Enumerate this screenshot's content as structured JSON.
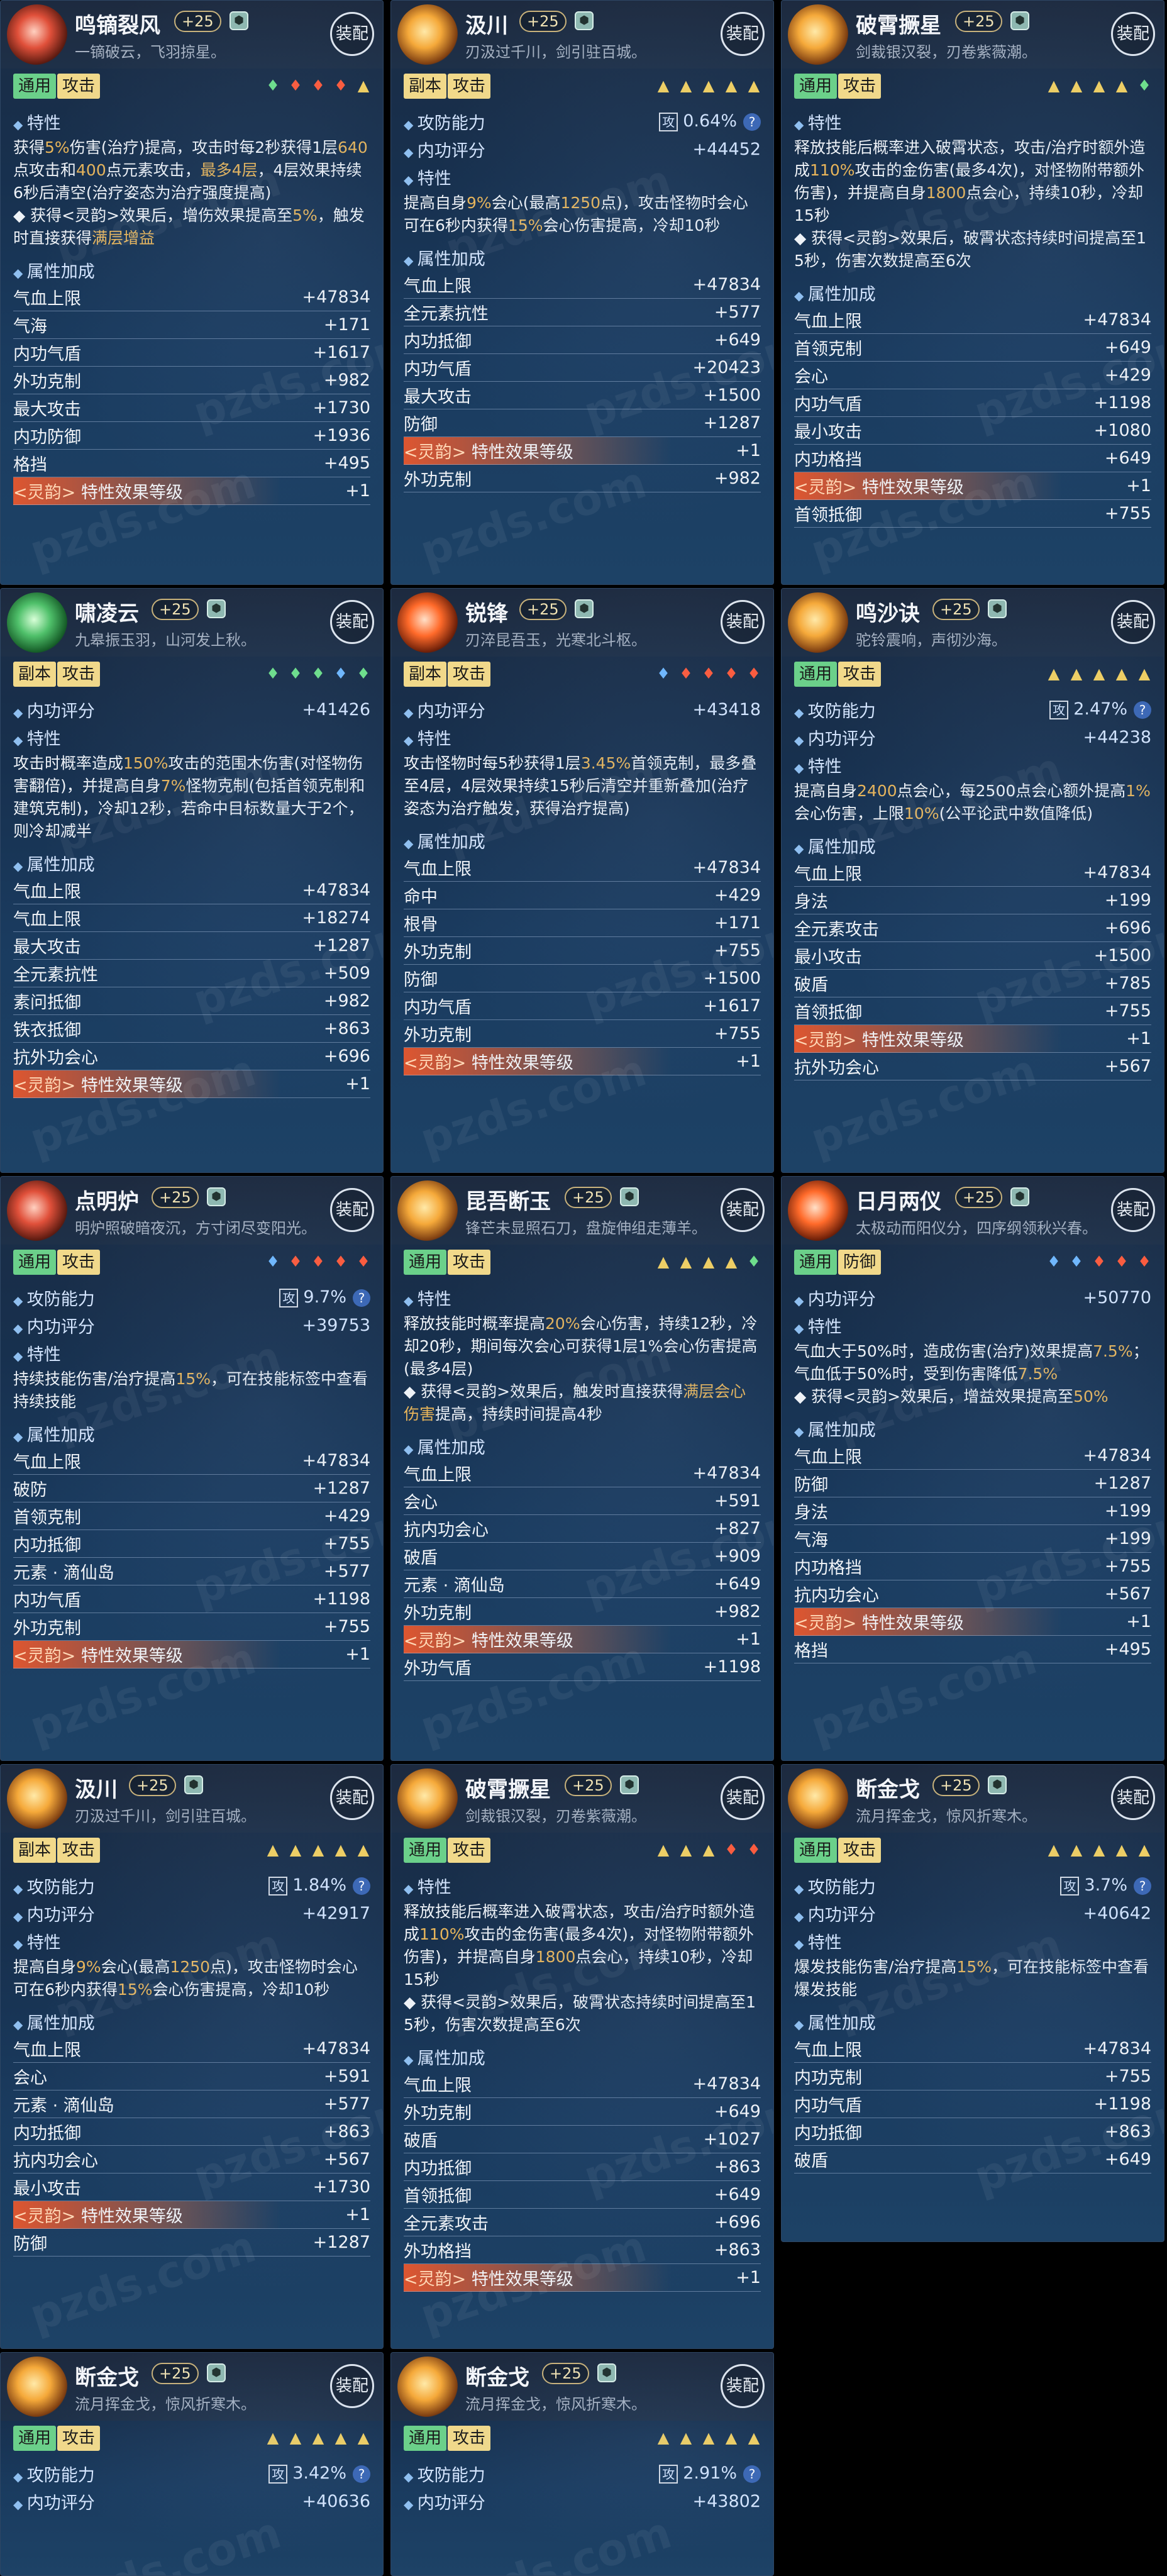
{
  "equip_label": "装配",
  "sections": {
    "trait": "特性",
    "attr": "属性加成"
  },
  "hl_prefix": "<灵韵>",
  "watermark": "pzds.com",
  "cards": [
    {
      "name": "鸣镝裂风",
      "level": "+25",
      "motto": "一镝破云，飞羽掠星。",
      "tags": [
        "通用",
        "攻击"
      ],
      "tag_colors": [
        "g",
        "y"
      ],
      "dots": [
        "wood",
        "fire",
        "fire",
        "fire",
        "bell"
      ],
      "icon": "c1",
      "top": [],
      "desc": [
        {
          "t": "获得"
        },
        {
          "t": "5%",
          "h": 1
        },
        {
          "t": "伤害(治疗)提高，攻击时每2秒获得1层"
        },
        {
          "t": "640",
          "h": 1
        },
        {
          "t": "点攻击和"
        },
        {
          "t": "400",
          "h": 1
        },
        {
          "t": "点元素攻击，"
        },
        {
          "t": "最多4层",
          "h": 1
        },
        {
          "t": "，4层效果持续6秒后清空(治疗姿态为治疗强度提高)"
        },
        {
          "t": "\n◆ 获得<灵韵>效果后，增伤效果提高至"
        },
        {
          "t": "5%",
          "h": 1
        },
        {
          "t": "，触发时直接获得"
        },
        {
          "t": "满层增益",
          "h": 1
        }
      ],
      "attrs": [
        [
          "气血上限",
          "+47834"
        ],
        [
          "气海",
          "+171"
        ],
        [
          "内功气盾",
          "+1617"
        ],
        [
          "外功克制",
          "+982"
        ],
        [
          "最大攻击",
          "+1730"
        ],
        [
          "内功防御",
          "+1936"
        ],
        [
          "格挡",
          "+495"
        ]
      ],
      "hl_index": 7,
      "hl_label": "特性效果等级",
      "hl_val": "+1"
    },
    {
      "name": "汲川",
      "level": "+25",
      "motto": "刃汲过千川，剑引驻百城。",
      "tags": [
        "副本",
        "攻击"
      ],
      "tag_colors": [
        "y",
        "y"
      ],
      "dots": [
        "gold",
        "gold",
        "gold",
        "gold",
        "gold"
      ],
      "icon": "",
      "top": [
        [
          "攻防能力",
          "0.64%",
          true
        ],
        [
          "内功评分",
          "+44452",
          false
        ]
      ],
      "desc": [
        {
          "t": "提高自身"
        },
        {
          "t": "9%",
          "h": 1
        },
        {
          "t": "会心(最高"
        },
        {
          "t": "1250",
          "h": 1
        },
        {
          "t": "点)，攻击怪物时会心可在6秒内获得"
        },
        {
          "t": "15%",
          "h": 1
        },
        {
          "t": "会心伤害提高，冷却10秒"
        }
      ],
      "attrs": [
        [
          "气血上限",
          "+47834"
        ],
        [
          "全元素抗性",
          "+577"
        ],
        [
          "内功抵御",
          "+649"
        ],
        [
          "内功气盾",
          "+20423"
        ],
        [
          "最大攻击",
          "+1500"
        ],
        [
          "防御",
          "+1287"
        ],
        [
          "外功克制",
          "+982"
        ]
      ],
      "hl_index": 6,
      "hl_label": "特性效果等级",
      "hl_val": "+1"
    },
    {
      "name": "破霄撅星",
      "level": "+25",
      "motto": "剑裁银汉裂，刃卷紫薇潮。",
      "tags": [
        "通用",
        "攻击"
      ],
      "tag_colors": [
        "g",
        "y"
      ],
      "dots": [
        "gold",
        "gold",
        "gold",
        "gold",
        "wood"
      ],
      "icon": "",
      "top": [],
      "desc": [
        {
          "t": "释放技能后概率进入破霄状态，攻击/治疗时额外造成"
        },
        {
          "t": "110%",
          "h": 1
        },
        {
          "t": "攻击的金伤害(最多4次)，对怪物附带额外伤害)，并提高自身"
        },
        {
          "t": "1800",
          "h": 1
        },
        {
          "t": "点会心，持续10秒，冷却15秒"
        },
        {
          "t": "\n◆ 获得<灵韵>效果后，破霄状态持续时间提高至15秒，伤害次数提高至6次"
        }
      ],
      "attrs": [
        [
          "气血上限",
          "+47834"
        ],
        [
          "首领克制",
          "+649"
        ],
        [
          "会心",
          "+429"
        ],
        [
          "内功气盾",
          "+1198"
        ],
        [
          "最小攻击",
          "+1080"
        ],
        [
          "内功格挡",
          "+649"
        ],
        [
          "首领抵御",
          "+755"
        ]
      ],
      "hl_index": 6,
      "hl_label": "特性效果等级",
      "hl_val": "+1"
    },
    {
      "name": "啸凌云",
      "level": "+25",
      "motto": "九皋振玉羽，山河发上秋。",
      "tags": [
        "副本",
        "攻击"
      ],
      "tag_colors": [
        "y",
        "y"
      ],
      "dots": [
        "wood",
        "wood",
        "wood",
        "water",
        "wood"
      ],
      "icon": "c2",
      "top": [
        [
          "内功评分",
          "+41426",
          false
        ]
      ],
      "desc": [
        {
          "t": "攻击时概率造成"
        },
        {
          "t": "150%",
          "h": 1
        },
        {
          "t": "攻击的范围木伤害(对怪物伤害翻倍)，并提高自身"
        },
        {
          "t": "7%",
          "h": 1
        },
        {
          "t": "怪物克制(包括首领克制和建筑克制)，冷却12秒，若命中目标数量大于2个，则冷却减半"
        }
      ],
      "attrs": [
        [
          "气血上限",
          "+47834"
        ],
        [
          "气血上限",
          "+18274"
        ],
        [
          "最大攻击",
          "+1287"
        ],
        [
          "全元素抗性",
          "+509"
        ],
        [
          "素问抵御",
          "+982"
        ],
        [
          "铁衣抵御",
          "+863"
        ],
        [
          "抗外功会心",
          "+696"
        ]
      ],
      "hl_index": 7,
      "hl_label": "特性效果等级",
      "hl_val": "+1"
    },
    {
      "name": "锐锋",
      "level": "+25",
      "motto": "刃淬昆吾玉，光寒北斗枢。",
      "tags": [
        "副本",
        "攻击"
      ],
      "tag_colors": [
        "y",
        "y"
      ],
      "dots": [
        "water",
        "fire",
        "fire",
        "fire",
        "fire"
      ],
      "icon": "c3",
      "top": [
        [
          "内功评分",
          "+43418",
          false
        ]
      ],
      "desc": [
        {
          "t": "攻击怪物时每5秒获得1层"
        },
        {
          "t": "3.45%",
          "h": 1
        },
        {
          "t": "首领克制，最多叠至4层，4层效果持续15秒后清空并重新叠加(治疗姿态为治疗触发，获得治疗提高)"
        }
      ],
      "attrs": [
        [
          "气血上限",
          "+47834"
        ],
        [
          "命中",
          "+429"
        ],
        [
          "根骨",
          "+171"
        ],
        [
          "外功克制",
          "+755"
        ],
        [
          "防御",
          "+1500"
        ],
        [
          "内功气盾",
          "+1617"
        ],
        [
          "外功克制",
          "+755"
        ]
      ],
      "hl_index": 7,
      "hl_label": "特性效果等级",
      "hl_val": "+1"
    },
    {
      "name": "鸣沙诀",
      "level": "+25",
      "motto": "驼铃震响，声彻沙海。",
      "tags": [
        "通用",
        "攻击"
      ],
      "tag_colors": [
        "g",
        "y"
      ],
      "dots": [
        "gold",
        "gold",
        "gold",
        "gold",
        "gold"
      ],
      "icon": "",
      "top": [
        [
          "攻防能力",
          "2.47%",
          true
        ],
        [
          "内功评分",
          "+44238",
          false
        ]
      ],
      "desc": [
        {
          "t": "提高自身"
        },
        {
          "t": "2400",
          "h": 1
        },
        {
          "t": "点会心，每2500点会心额外提高"
        },
        {
          "t": "1%",
          "h": 1
        },
        {
          "t": "会心伤害，上限"
        },
        {
          "t": "10%",
          "h": 1
        },
        {
          "t": "(公平论武中数值降低)"
        }
      ],
      "attrs": [
        [
          "气血上限",
          "+47834"
        ],
        [
          "身法",
          "+199"
        ],
        [
          "全元素攻击",
          "+696"
        ],
        [
          "最小攻击",
          "+1500"
        ],
        [
          "破盾",
          "+785"
        ],
        [
          "首领抵御",
          "+755"
        ],
        [
          "抗外功会心",
          "+567"
        ]
      ],
      "hl_index": 6,
      "hl_label": "特性效果等级",
      "hl_val": "+1"
    },
    {
      "name": "点明炉",
      "level": "+25",
      "motto": "明炉照破暗夜沉，方寸闭尽变阳光。",
      "tags": [
        "通用",
        "攻击"
      ],
      "tag_colors": [
        "g",
        "y"
      ],
      "dots": [
        "water",
        "fire",
        "fire",
        "fire",
        "fire"
      ],
      "icon": "c1",
      "top": [
        [
          "攻防能力",
          "9.7%",
          true
        ],
        [
          "内功评分",
          "+39753",
          false
        ]
      ],
      "desc": [
        {
          "t": "持续技能伤害/治疗提高"
        },
        {
          "t": "15%",
          "h": 1
        },
        {
          "t": "，可在技能标签中查看持续技能"
        }
      ],
      "attrs": [
        [
          "气血上限",
          "+47834"
        ],
        [
          "破防",
          "+1287"
        ],
        [
          "首领克制",
          "+429"
        ],
        [
          "内功抵御",
          "+755"
        ],
        [
          "元素 · 滴仙岛",
          "+577"
        ],
        [
          "内功气盾",
          "+1198"
        ],
        [
          "外功克制",
          "+755"
        ]
      ],
      "hl_index": 7,
      "hl_label": "特性效果等级",
      "hl_val": "+1"
    },
    {
      "name": "昆吾断玉",
      "level": "+25",
      "motto": "锋芒未显照石刀，盘旋伸组走薄羊。",
      "tags": [
        "通用",
        "攻击"
      ],
      "tag_colors": [
        "g",
        "y"
      ],
      "dots": [
        "gold",
        "gold",
        "gold",
        "gold",
        "wood"
      ],
      "icon": "",
      "top": [],
      "desc": [
        {
          "t": "释放技能时概率提高"
        },
        {
          "t": "20%",
          "h": 1
        },
        {
          "t": "会心伤害，持续12秒，冷却20秒，期间每次会心可获得1层1%会心伤害提高(最多4层)"
        },
        {
          "t": "\n◆ 获得<灵韵>效果后，触发时直接获得"
        },
        {
          "t": "满层会心伤害",
          "h": 1
        },
        {
          "t": "提高，持续时间提高4秒"
        }
      ],
      "attrs": [
        [
          "气血上限",
          "+47834"
        ],
        [
          "会心",
          "+591"
        ],
        [
          "抗内功会心",
          "+827"
        ],
        [
          "破盾",
          "+909"
        ],
        [
          "元素 · 滴仙岛",
          "+649"
        ],
        [
          "外功克制",
          "+982"
        ],
        [
          "外功气盾",
          "+1198"
        ]
      ],
      "hl_index": 6,
      "hl_label": "特性效果等级",
      "hl_val": "+1"
    },
    {
      "name": "日月两仪",
      "level": "+25",
      "motto": "太极动而阳仪分，四序纲领秋兴春。",
      "tags": [
        "通用",
        "防御"
      ],
      "tag_colors": [
        "g",
        "y"
      ],
      "dots": [
        "water",
        "water",
        "fire",
        "fire",
        "fire"
      ],
      "icon": "c3",
      "top": [
        [
          "内功评分",
          "+50770",
          false
        ]
      ],
      "desc": [
        {
          "t": "气血大于50%时，造成伤害(治疗)效果提高"
        },
        {
          "t": "7.5%",
          "h": 1
        },
        {
          "t": "；气血低于50%时，受到伤害降低"
        },
        {
          "t": "7.5%",
          "h": 1
        },
        {
          "t": "\n◆ 获得<灵韵>效果后，增益效果提高至"
        },
        {
          "t": "50%",
          "h": 1
        }
      ],
      "attrs": [
        [
          "气血上限",
          "+47834"
        ],
        [
          "防御",
          "+1287"
        ],
        [
          "身法",
          "+199"
        ],
        [
          "气海",
          "+199"
        ],
        [
          "内功格挡",
          "+755"
        ],
        [
          "抗内功会心",
          "+567"
        ],
        [
          "格挡",
          "+495"
        ]
      ],
      "hl_index": 6,
      "hl_label": "特性效果等级",
      "hl_val": "+1"
    },
    {
      "name": "汲川",
      "level": "+25",
      "motto": "刃汲过千川，剑引驻百城。",
      "tags": [
        "副本",
        "攻击"
      ],
      "tag_colors": [
        "y",
        "y"
      ],
      "dots": [
        "gold",
        "gold",
        "gold",
        "gold",
        "gold"
      ],
      "icon": "",
      "top": [
        [
          "攻防能力",
          "1.84%",
          true
        ],
        [
          "内功评分",
          "+42917",
          false
        ]
      ],
      "desc": [
        {
          "t": "提高自身"
        },
        {
          "t": "9%",
          "h": 1
        },
        {
          "t": "会心(最高"
        },
        {
          "t": "1250",
          "h": 1
        },
        {
          "t": "点)，攻击怪物时会心可在6秒内获得"
        },
        {
          "t": "15%",
          "h": 1
        },
        {
          "t": "会心伤害提高，冷却10秒"
        }
      ],
      "attrs": [
        [
          "气血上限",
          "+47834"
        ],
        [
          "会心",
          "+591"
        ],
        [
          "元素 · 滴仙岛",
          "+577"
        ],
        [
          "内功抵御",
          "+863"
        ],
        [
          "抗内功会心",
          "+567"
        ],
        [
          "最小攻击",
          "+1730"
        ],
        [
          "防御",
          "+1287"
        ]
      ],
      "hl_index": 6,
      "hl_label": "特性效果等级",
      "hl_val": "+1"
    },
    {
      "name": "破霄撅星",
      "level": "+25",
      "motto": "剑裁银汉裂，刃卷紫薇潮。",
      "tags": [
        "通用",
        "攻击"
      ],
      "tag_colors": [
        "g",
        "y"
      ],
      "dots": [
        "gold",
        "gold",
        "gold",
        "fire",
        "fire"
      ],
      "icon": "",
      "top": [],
      "desc": [
        {
          "t": "释放技能后概率进入破霄状态，攻击/治疗时额外造成"
        },
        {
          "t": "110%",
          "h": 1
        },
        {
          "t": "攻击的金伤害(最多4次)，对怪物附带额外伤害)，并提高自身"
        },
        {
          "t": "1800",
          "h": 1
        },
        {
          "t": "点会心，持续10秒，冷却15秒"
        },
        {
          "t": "\n◆ 获得<灵韵>效果后，破霄状态持续时间提高至15秒，伤害次数提高至6次"
        }
      ],
      "attrs": [
        [
          "气血上限",
          "+47834"
        ],
        [
          "外功克制",
          "+649"
        ],
        [
          "破盾",
          "+1027"
        ],
        [
          "内功抵御",
          "+863"
        ],
        [
          "首领抵御",
          "+649"
        ],
        [
          "全元素攻击",
          "+696"
        ],
        [
          "外功格挡",
          "+863"
        ]
      ],
      "hl_index": 7,
      "hl_label": "特性效果等级",
      "hl_val": "+1"
    },
    {
      "name": "断金戈",
      "level": "+25",
      "motto": "流月挥金戈，惊风折寒木。",
      "tags": [
        "通用",
        "攻击"
      ],
      "tag_colors": [
        "g",
        "y"
      ],
      "dots": [
        "gold",
        "gold",
        "gold",
        "gold",
        "gold"
      ],
      "icon": "",
      "top": [
        [
          "攻防能力",
          "3.7%",
          true
        ],
        [
          "内功评分",
          "+40642",
          false
        ]
      ],
      "desc": [
        {
          "t": "爆发技能伤害/治疗提高"
        },
        {
          "t": "15%",
          "h": 1
        },
        {
          "t": "，可在技能标签中查看爆发技能"
        }
      ],
      "attrs": [
        [
          "气血上限",
          "+47834"
        ],
        [
          "内功克制",
          "+755"
        ],
        [
          "内功气盾",
          "+1198"
        ],
        [
          "内功抵御",
          "+863"
        ],
        [
          "破盾",
          "+649"
        ]
      ],
      "hl_index": -1,
      "hl_label": "",
      "hl_val": ""
    },
    {
      "name": "断金戈",
      "level": "+25",
      "motto": "流月挥金戈，惊风折寒木。",
      "tags": [
        "通用",
        "攻击"
      ],
      "tag_colors": [
        "g",
        "y"
      ],
      "dots": [
        "gold",
        "gold",
        "gold",
        "gold",
        "gold"
      ],
      "icon": "",
      "top": [
        [
          "攻防能力",
          "3.42%",
          true
        ],
        [
          "内功评分",
          "+40636",
          false
        ]
      ],
      "desc": [],
      "attrs": [],
      "hl_index": -1,
      "hl_label": "",
      "hl_val": ""
    },
    {
      "name": "断金戈",
      "level": "+25",
      "motto": "流月挥金戈，惊风折寒木。",
      "tags": [
        "通用",
        "攻击"
      ],
      "tag_colors": [
        "g",
        "y"
      ],
      "dots": [
        "gold",
        "gold",
        "gold",
        "gold",
        "gold"
      ],
      "icon": "",
      "top": [
        [
          "攻防能力",
          "2.91%",
          true
        ],
        [
          "内功评分",
          "+43802",
          false
        ]
      ],
      "desc": [],
      "attrs": [],
      "hl_index": -1,
      "hl_label": "",
      "hl_val": ""
    }
  ]
}
